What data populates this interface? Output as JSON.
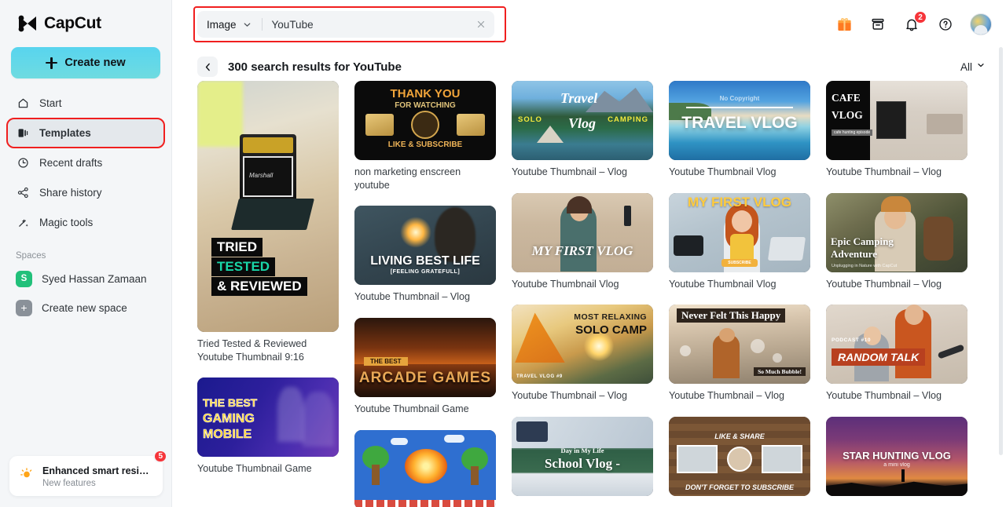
{
  "brand": {
    "name": "CapCut",
    "logo_icon": "capcut-logo-icon"
  },
  "sidebar": {
    "create_new_label": "Create new",
    "nav": [
      {
        "label": "Start",
        "icon": "home-icon",
        "active": false
      },
      {
        "label": "Templates",
        "icon": "templates-icon",
        "active": true,
        "highlighted": true
      },
      {
        "label": "Recent drafts",
        "icon": "clock-icon",
        "active": false
      },
      {
        "label": "Share history",
        "icon": "share-icon",
        "active": false
      },
      {
        "label": "Magic tools",
        "icon": "magic-wand-icon",
        "active": false
      }
    ],
    "spaces_title": "Spaces",
    "spaces": [
      {
        "label": "Syed Hassan Zamaan",
        "initial": "S",
        "color": "#21c07a"
      },
      {
        "label": "Create new space",
        "initial": "+",
        "color": "#8a9199"
      }
    ],
    "promo": {
      "title": "Enhanced smart resi…",
      "subtitle": "New features",
      "badge": "5",
      "icon": "lightbulb-icon"
    }
  },
  "topbar": {
    "search": {
      "type_label": "Image",
      "value": "YouTube",
      "placeholder": "Search",
      "chevron_icon": "chevron-down-icon",
      "clear_icon": "close-icon",
      "highlight_color": "#f01f1f"
    },
    "actions": [
      {
        "name": "gift-icon",
        "glyph": "gift"
      },
      {
        "name": "archive-icon",
        "glyph": "archive"
      },
      {
        "name": "notification-bell-icon",
        "glyph": "bell",
        "badge": "2"
      },
      {
        "name": "help-icon",
        "glyph": "help"
      }
    ],
    "avatar_name": "user-avatar"
  },
  "results": {
    "back_icon": "chevron-left-icon",
    "title": "300 search results for YouTube",
    "filter_label": "All",
    "filter_icon": "chevron-down-icon"
  },
  "grid": {
    "columns": [
      {
        "cards": [
          {
            "label": "Tried Tested & Reviewed Youtube Thumbnail 9:16",
            "ratio": "9:16",
            "art": "tried-tested",
            "overlay": [
              "TRIED",
              "TESTED",
              "& REVIEWED"
            ]
          },
          {
            "label": "Youtube Thumbnail Game",
            "ratio": "16:9",
            "art": "gaming-mobile",
            "overlay": [
              "THE BEST",
              "GAMING",
              "MOBILE"
            ]
          }
        ]
      },
      {
        "cards": [
          {
            "label": "non marketing enscreen youtube",
            "ratio": "16:9",
            "art": "thank-you",
            "overlay": [
              "THANK YOU",
              "FOR WATCHING",
              "LIKE & SUBSCRIBE"
            ]
          },
          {
            "label": "Youtube Thumbnail – Vlog",
            "ratio": "16:9",
            "art": "living-best-life",
            "overlay": [
              "LIVING BEST LIFE",
              "[FEELING GRATEFULL]"
            ]
          },
          {
            "label": "Youtube Thumbnail Game",
            "ratio": "16:9",
            "art": "arcade-games",
            "overlay": [
              "THE BEST",
              "ARCADE GAMES"
            ]
          },
          {
            "label": "",
            "ratio": "16:9",
            "art": "pixel-game",
            "overlay": []
          }
        ]
      },
      {
        "cards": [
          {
            "label": "Youtube Thumbnail – Vlog",
            "ratio": "16:9",
            "art": "travel-vlog-camping",
            "overlay": [
              "SOLO",
              "Travel",
              "Vlog",
              "CAMPING"
            ]
          },
          {
            "label": "Youtube Thumbnail Vlog",
            "ratio": "16:9",
            "art": "my-first-vlog-girl",
            "overlay": [
              "MY FIRST VLOG"
            ]
          },
          {
            "label": "Youtube Thumbnail – Vlog",
            "ratio": "16:9",
            "art": "solo-camp",
            "overlay": [
              "MOST RELAXING",
              "SOLO CAMP",
              "TRAVEL VLOG #9"
            ]
          },
          {
            "label": "",
            "ratio": "16:9",
            "art": "school-vlog",
            "overlay": [
              "Day in My Life",
              "School Vlog -"
            ]
          }
        ]
      },
      {
        "cards": [
          {
            "label": "Youtube Thumbnail Vlog",
            "ratio": "16:9",
            "art": "travel-vlog-beach",
            "overlay": [
              "No Copyright",
              "TRAVEL VLOG"
            ]
          },
          {
            "label": "Youtube Thumbnail Vlog",
            "ratio": "16:9",
            "art": "my-first-vlog-redhead",
            "overlay": [
              "MY FIRST VLOG",
              "SUBSCRIBE"
            ]
          },
          {
            "label": "Youtube Thumbnail – Vlog",
            "ratio": "16:9",
            "art": "never-felt-happy",
            "overlay": [
              "Never Felt This Happy",
              "So Much Bubble!"
            ]
          },
          {
            "label": "",
            "ratio": "16:9",
            "art": "like-and-share",
            "overlay": [
              "LIKE & SHARE",
              "DON'T FORGET TO SUBSCRIBE"
            ]
          }
        ]
      },
      {
        "cards": [
          {
            "label": "Youtube Thumbnail – Vlog",
            "ratio": "16:9",
            "art": "cafe-vlog",
            "overlay": [
              "CAFE",
              "VLOG",
              "cafe hunting episode"
            ]
          },
          {
            "label": "Youtube Thumbnail – Vlog",
            "ratio": "16:9",
            "art": "epic-camping",
            "overlay": [
              "Epic Camping",
              "Adventure",
              "Unplugging in Nature with CapCut"
            ]
          },
          {
            "label": "Youtube Thumbnail – Vlog",
            "ratio": "16:9",
            "art": "random-talk",
            "overlay": [
              "PODCAST #10",
              "RANDOM TALK"
            ]
          },
          {
            "label": "",
            "ratio": "16:9",
            "art": "star-hunting",
            "overlay": [
              "STAR HUNTING VLOG",
              "a mini vlog"
            ]
          }
        ]
      }
    ]
  }
}
